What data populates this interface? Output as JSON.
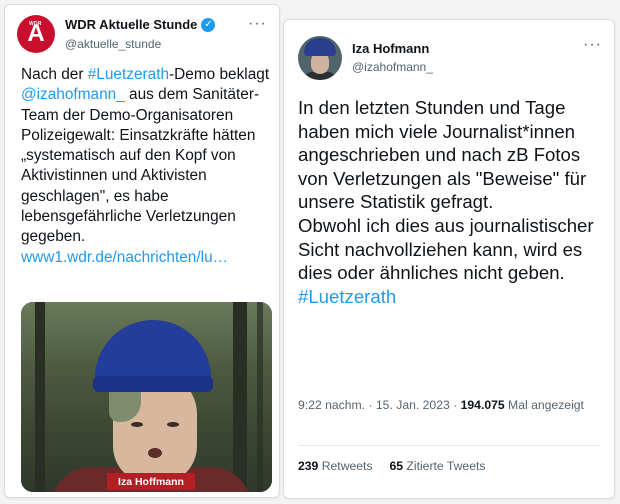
{
  "left_tweet": {
    "author_name": "WDR Aktuelle Stunde",
    "handle": "@aktuelle_stunde",
    "avatar_letter": "A",
    "avatar_small_text": "WDR",
    "more_label": "···",
    "text": {
      "t1": "Nach der ",
      "hashtag": "#Luetzerath",
      "t2": "-Demo beklagt ",
      "mention": "@izahofmann_",
      "t3": " aus dem Sanitäter-Team der Demo-Organisatoren Polizeigewalt: Einsatzkräfte hätten „systematisch auf den Kopf von Aktivistinnen und Aktivisten geschlagen\", es habe lebensgefährliche Verletzungen gegeben.",
      "link": "www1.wdr.de/nachrichten/lu…"
    },
    "image_caption": "Iza Hoffmann"
  },
  "right_tweet": {
    "author_name": "Iza Hofmann",
    "handle": "@izahofmann_",
    "more_label": "···",
    "text": {
      "p1": "In den letzten Stunden und Tage haben mich viele Journalist*innen angeschrieben und nach zB Fotos von Verletzungen als \"Beweise\" für unsere Statistik gefragt.",
      "p2": "Obwohl ich dies aus journalistischer Sicht nachvollziehen kann, wird es dies oder ähnliches nicht geben.",
      "hashtag": "#Luetzerath"
    },
    "meta": {
      "time_date": "9:22 nachm. · 15. Jan. 2023 · ",
      "views": "194.075",
      "views_label": " Mal angezeigt"
    },
    "stats": {
      "retweets": "239",
      "retweets_label": " Retweets",
      "quotes": "65",
      "quotes_label": " Zitierte Tweets"
    }
  },
  "colors": {
    "link_blue": "#1d9bf0",
    "wdr_red": "#c8102e",
    "caption_red": "#b21f24",
    "secondary_text": "#536471"
  }
}
